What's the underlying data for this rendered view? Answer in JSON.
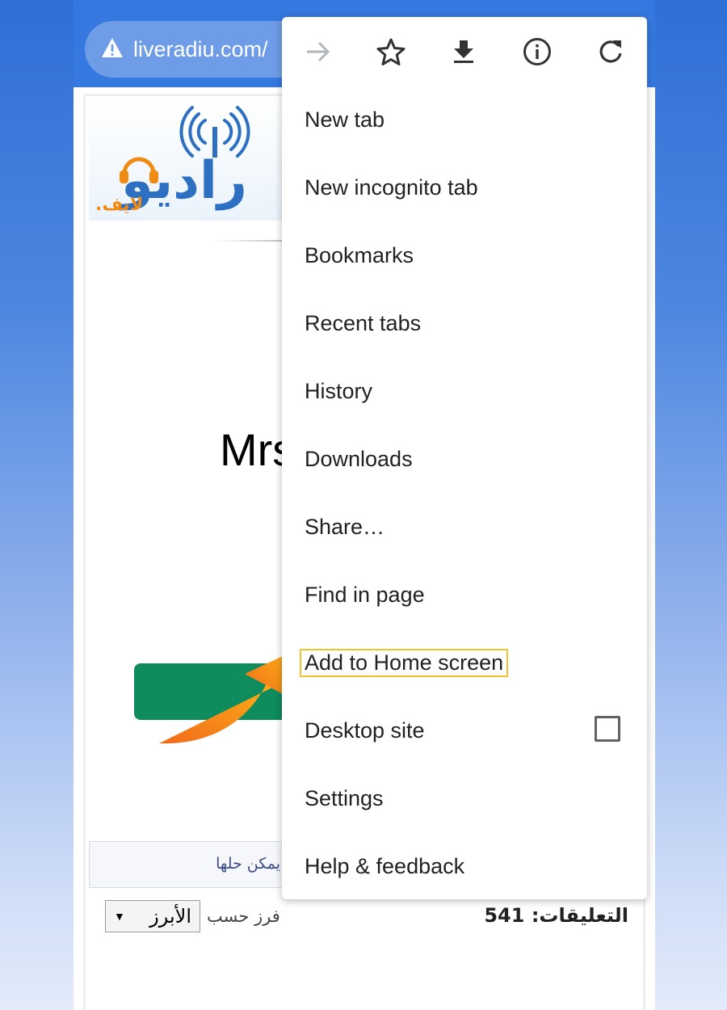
{
  "toolbar": {
    "url": "liveradiu.com/"
  },
  "page": {
    "logo_main": "راديو",
    "logo_sub": "لايف.",
    "headline": "Mrs",
    "hint_text": "يمكن حلها",
    "sort_label": "فرز حسب",
    "sort_value": "الأبرز",
    "sort_arrow": "▼",
    "comments_label": "التعليقات:",
    "comments_count": "541"
  },
  "menu": {
    "icons": [
      "forward-icon",
      "star-icon",
      "download-icon",
      "info-icon",
      "reload-icon"
    ],
    "items": [
      {
        "label": "New tab"
      },
      {
        "label": "New incognito tab"
      },
      {
        "label": "Bookmarks"
      },
      {
        "label": "Recent tabs"
      },
      {
        "label": "History"
      },
      {
        "label": "Downloads"
      },
      {
        "label": "Share…"
      },
      {
        "label": "Find in page"
      },
      {
        "label": "Add to Home screen"
      },
      {
        "label": "Desktop site"
      },
      {
        "label": "Settings"
      },
      {
        "label": "Help & feedback"
      }
    ]
  },
  "colors": {
    "toolbar": "#3579e0",
    "highlight": "#f3c230",
    "arrow": "#f7941d",
    "green_button": "#0e8c5e"
  }
}
